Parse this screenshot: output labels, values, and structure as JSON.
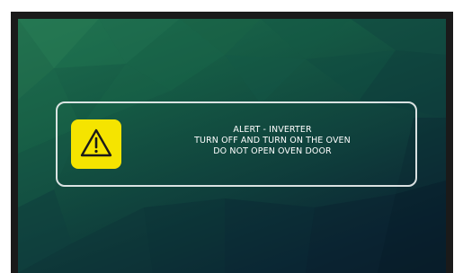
{
  "alert": {
    "title": "ALERT - INVERTER",
    "line1": "TURN OFF AND TURN ON THE OVEN",
    "line2": "DO NOT OPEN OVEN DOOR",
    "icon": "warning-triangle-icon"
  },
  "colors": {
    "warning_tile": "#f5e400",
    "warning_glyph": "#1a1a1a",
    "frame": "#1a1a1a",
    "border": "#ebf0f0",
    "text": "#ffffff"
  }
}
